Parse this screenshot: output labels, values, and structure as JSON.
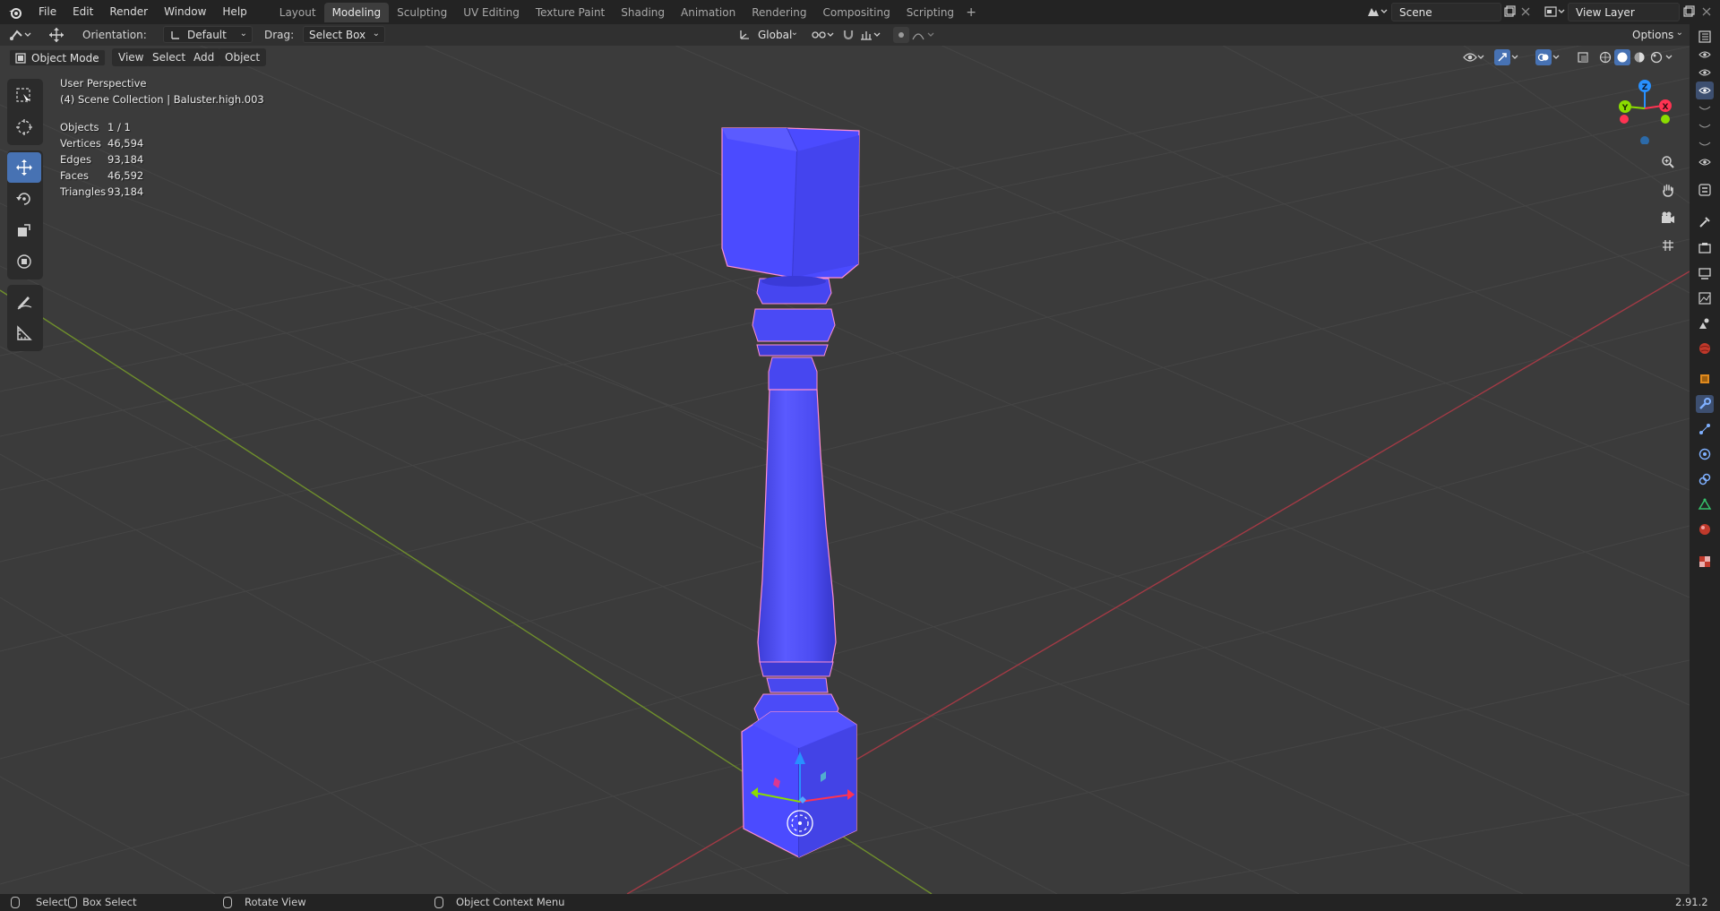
{
  "menu": {
    "items": [
      "File",
      "Edit",
      "Render",
      "Window",
      "Help"
    ]
  },
  "workspaces": {
    "tabs": [
      "Layout",
      "Modeling",
      "Sculpting",
      "UV Editing",
      "Texture Paint",
      "Shading",
      "Animation",
      "Rendering",
      "Compositing",
      "Scripting"
    ],
    "active": "Modeling",
    "add_label": "+"
  },
  "scene": {
    "name": "Scene",
    "view_layer": "View Layer"
  },
  "tool_settings": {
    "orientation_label": "Orientation:",
    "orientation_value": "Default",
    "drag_label": "Drag:",
    "drag_value": "Select Box",
    "transform_orientation": "Global",
    "options_label": "Options"
  },
  "viewport_header": {
    "mode": "Object Mode",
    "menus": [
      "View",
      "Select",
      "Add",
      "Object"
    ]
  },
  "overlay": {
    "perspective": "User Perspective",
    "collection": "(4) Scene Collection | Baluster.high.003",
    "stats": [
      {
        "key": "Objects",
        "value": "1 / 1"
      },
      {
        "key": "Vertices",
        "value": "46,594"
      },
      {
        "key": "Edges",
        "value": "93,184"
      },
      {
        "key": "Faces",
        "value": "46,592"
      },
      {
        "key": "Triangles",
        "value": "93,184"
      }
    ]
  },
  "gizmo": {
    "x": "X",
    "y": "Y",
    "z": "Z"
  },
  "colors": {
    "object": "#4d4dff",
    "selection_outline": "#ff8fd0",
    "x_axis": "#ff3352",
    "y_axis": "#8bdc00",
    "z_axis": "#2890ff",
    "active_tool": "#4772b3"
  },
  "status_bar": {
    "select": "Select",
    "box_select": "Box Select",
    "rotate_view": "Rotate View",
    "context_menu": "Object Context Menu",
    "version": "2.91.2"
  }
}
